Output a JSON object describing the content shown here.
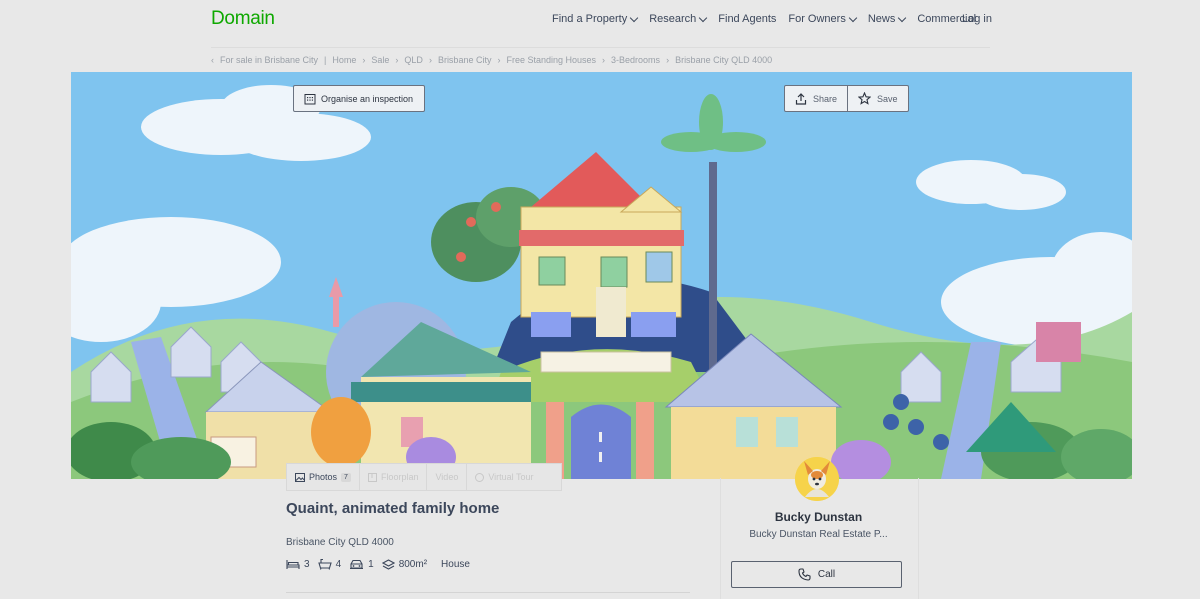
{
  "header": {
    "logo": "Domain",
    "nav": [
      {
        "label": "Find a Property",
        "dropdown": true
      },
      {
        "label": "Research",
        "dropdown": true
      },
      {
        "label": "Find Agents",
        "dropdown": false
      },
      {
        "label": "For Owners",
        "dropdown": true
      },
      {
        "label": "News",
        "dropdown": true
      },
      {
        "label": "Commercial",
        "dropdown": false
      }
    ],
    "login": "Log in"
  },
  "breadcrumb": {
    "back": "For sale in Brisbane City",
    "items": [
      "Home",
      "Sale",
      "QLD",
      "Brisbane City",
      "Free Standing Houses",
      "3-Bedrooms",
      "Brisbane City QLD 4000"
    ]
  },
  "hero_actions": {
    "inspection": "Organise an inspection",
    "share": "Share",
    "save": "Save"
  },
  "media_tabs": {
    "photos": "Photos",
    "photos_count": "7",
    "tab2": "Floorplan",
    "tab3": "Video",
    "tab4": "Virtual Tour"
  },
  "listing": {
    "title": "Quaint, animated family home",
    "address": "Brisbane City QLD 4000",
    "beds": "3",
    "baths": "4",
    "parking": "1",
    "land": "800m²",
    "type": "House"
  },
  "agent": {
    "name": "Bucky Dunstan",
    "agency": "Bucky Dunstan Real Estate P...",
    "call": "Call"
  },
  "colors": {
    "brand": "#0ea800",
    "text": "#3c475b",
    "sky": "#7fc4ef"
  }
}
